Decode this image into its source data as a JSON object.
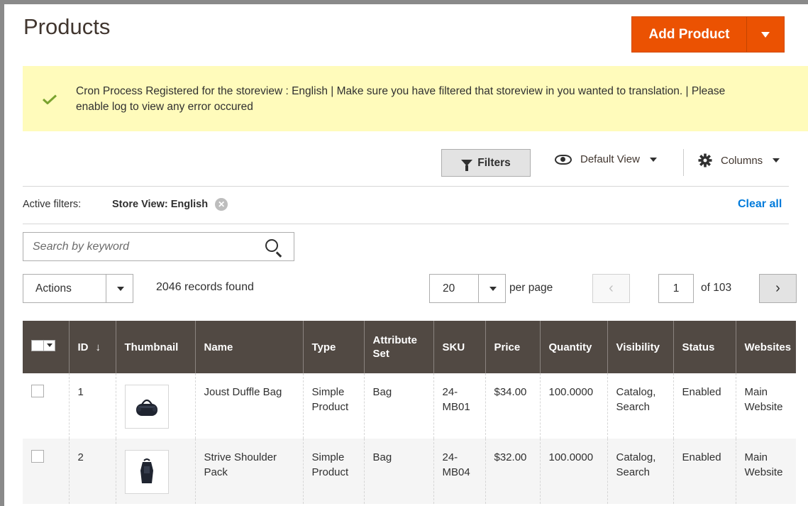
{
  "page": {
    "title": "Products"
  },
  "add_product": {
    "label": "Add Product"
  },
  "notice": {
    "message": "Cron Process Registered for the storeview : English | Make sure you have filtered that storeview in you wanted to translation. | Please enable log to view any error occured"
  },
  "toolbar": {
    "filters_label": "Filters",
    "view_label": "Default View",
    "columns_label": "Columns"
  },
  "active_filters": {
    "label": "Active filters:",
    "chip": "Store View: English",
    "clear_all": "Clear all"
  },
  "search": {
    "placeholder": "Search by keyword"
  },
  "actions": {
    "label": "Actions"
  },
  "records": {
    "text": "2046 records found"
  },
  "pagination": {
    "per_page_value": "20",
    "per_page_label": "per page",
    "current_page": "1",
    "of_pages": "of 103"
  },
  "grid": {
    "headers": {
      "id": "ID",
      "sort_arrow": "↓",
      "thumbnail": "Thumbnail",
      "name": "Name",
      "type": "Type",
      "attribute_set": "Attribute Set",
      "sku": "SKU",
      "price": "Price",
      "quantity": "Quantity",
      "visibility": "Visibility",
      "status": "Status",
      "websites": "Websites"
    },
    "rows": [
      {
        "id": "1",
        "name": "Joust Duffle Bag",
        "type": "Simple Product",
        "attribute_set": "Bag",
        "sku": "24-MB01",
        "price": "$34.00",
        "quantity": "100.0000",
        "visibility": "Catalog, Search",
        "status": "Enabled",
        "websites": "Main Website"
      },
      {
        "id": "2",
        "name": "Strive Shoulder Pack",
        "type": "Simple Product",
        "attribute_set": "Bag",
        "sku": "24-MB04",
        "price": "$32.00",
        "quantity": "100.0000",
        "visibility": "Catalog, Search",
        "status": "Enabled",
        "websites": "Main Website"
      }
    ]
  },
  "colors": {
    "accent": "#eb5202",
    "header_bg": "#514943",
    "notice_bg": "#fffbbb",
    "link": "#007bdb",
    "success": "#79a22e"
  }
}
